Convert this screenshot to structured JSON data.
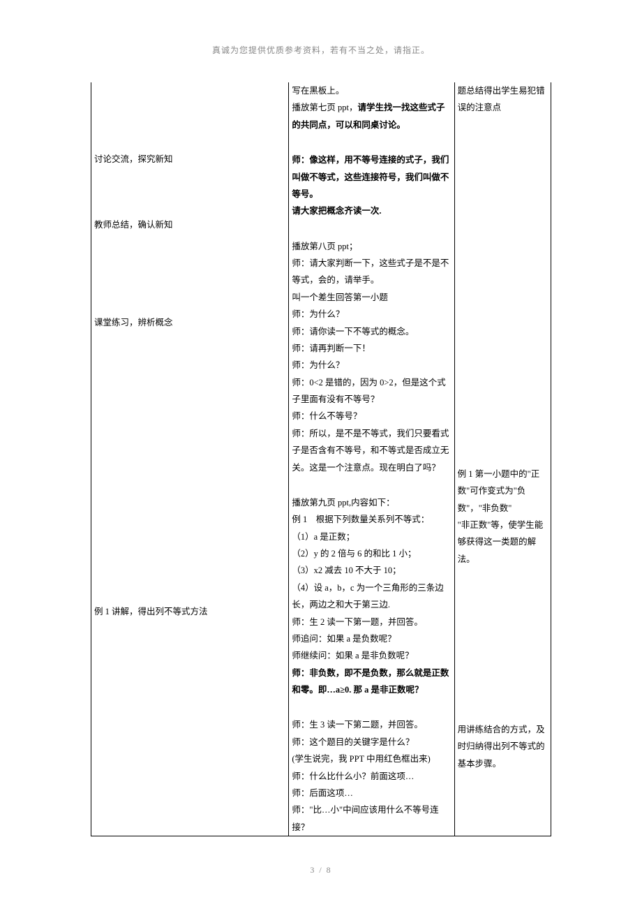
{
  "header": "真诚为您提供优质参考资料，若有不当之处，请指正。",
  "footer": "3 / 8",
  "col1": {
    "l1": "讨论交流，探究新知",
    "l2": "教师总结，确认新知",
    "l3": "课堂练习，辨析概念",
    "l4": "例 1 讲解，得出列不等式方法"
  },
  "col2": {
    "p1": "写在黑板上。",
    "p2a": "播放第七页 ppt，",
    "p2b": "请学生找一找这些式子的共同点，可以和同桌讨论。",
    "p3": "师：像这样，用不等号连接的式子，我们叫做不等式，这些连接符号，我们叫做不等号。",
    "p4": "请大家把概念齐读一次.",
    "p5": "播放第八页 ppt；",
    "p6": "师：请大家判断一下，这些式子是不是不等式，会的，请举手。",
    "p7": "叫一个差生回答第一小题",
    "p8": "师：为什么？",
    "p9": "师：请你读一下不等式的概念。",
    "p10": "师：请再判断一下！",
    "p11": "师：为什么？",
    "p12": "师：0<2 是错的，因为 0>2，但是这个式子里面有没有不等号？",
    "p13": "师：什么不等号？",
    "p14": "师：所以，是不是不等式，我们只要看式子是否含有不等号，和不等式是否成立无关。这是一个注意点。现在明白了吗？",
    "p15": "播放第九页 ppt,内容如下：",
    "p16": "例 1　根据下列数量关系列不等式：",
    "p17": "（1）a 是正数；",
    "p18": "（2）y 的 2 倍与 6 的和比 1 小；",
    "p19": "（3）x2 减去 10 不大于 10；",
    "p20": "（4）设 a，b，c 为一个三角形的三条边长，两边之和大于第三边.",
    "p21": "师：生 2 读一下第一题，并回答。",
    "p22": "师追问：如果 a 是负数呢？",
    "p23": "师继续问：如果 a 是非负数呢？",
    "p24": "师：非负数，即不是负数，那么就是正数和零。即…a≥0. 那 a 是非正数呢？",
    "p25": "师：生 3 读一下第二题，并回答。",
    "p26": "师：这个题目的关键字是什么？",
    "p27": "(学生说完，我 PPT 中用红色框出来)",
    "p28": "师：什么比什么小？前面这项…",
    "p29": "师：后面这项…",
    "p30": "师：\"比…小\"中间应该用什么不等号连接？"
  },
  "col3": {
    "r1": "题总结得出学生易犯错误的注意点",
    "r2": "例 1 第一小题中的\"正数\"可作变式为\"负数\"，\"非负数\"",
    "r3": "\"非正数\"等，使学生能够获得这一类题的解法。",
    "r4": "用讲练结合的方式，及时归纳得出列不等式的基本步骤。"
  }
}
